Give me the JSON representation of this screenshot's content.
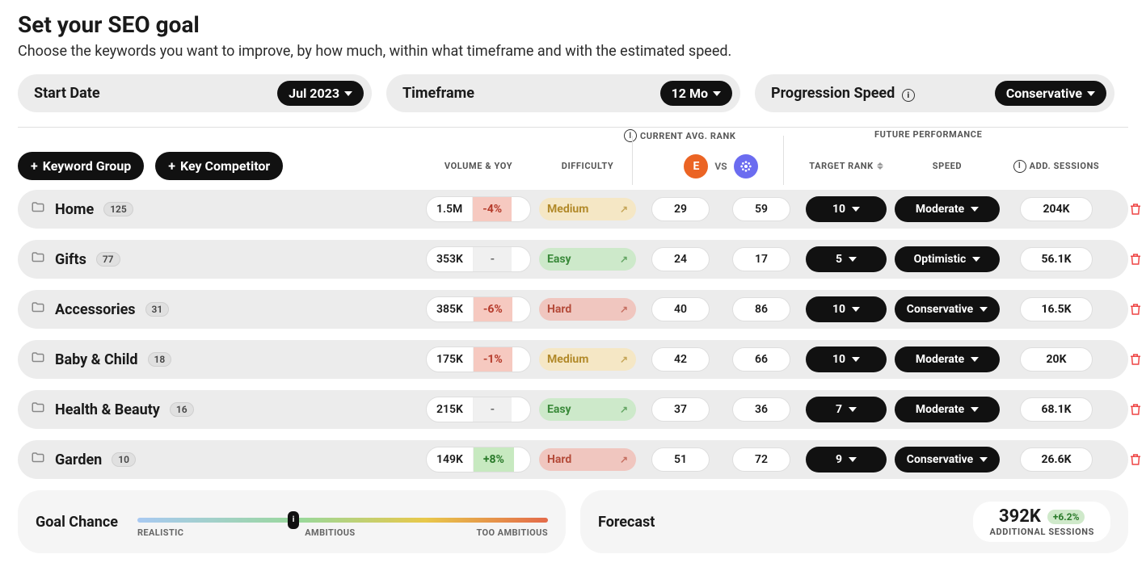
{
  "title": "Set your SEO goal",
  "subtitle": "Choose the keywords you want to improve, by how much, within what timeframe and with the estimated speed.",
  "controls": {
    "start_date": {
      "label": "Start Date",
      "value": "Jul 2023"
    },
    "timeframe": {
      "label": "Timeframe",
      "value": "12 Mo"
    },
    "speed": {
      "label": "Progression Speed",
      "value": "Conservative"
    }
  },
  "columns": {
    "volyoy": "VOLUME & YOY",
    "difficulty": "DIFFICULTY",
    "rank_header": "CURRENT AVG. RANK",
    "future_header": "FUTURE PERFORMANCE",
    "vs": "VS",
    "target_rank": "TARGET RANK",
    "speed": "SPEED",
    "sessions": "ADD. SESSIONS"
  },
  "buttons": {
    "keyword_group": "Keyword Group",
    "key_competitor": "Key Competitor"
  },
  "avatars": {
    "own": "E"
  },
  "rows": [
    {
      "name": "Home",
      "count": "125",
      "vol": "1.5M",
      "yoy": "-4%",
      "yoy_type": "neg",
      "diff": "Medium",
      "diff_type": "medium",
      "r1": "29",
      "r2": "59",
      "target": "10",
      "speed": "Moderate",
      "sess": "204K"
    },
    {
      "name": "Gifts",
      "count": "77",
      "vol": "353K",
      "yoy": "-",
      "yoy_type": "neutral",
      "diff": "Easy",
      "diff_type": "easy",
      "r1": "24",
      "r2": "17",
      "target": "5",
      "speed": "Optimistic",
      "sess": "56.1K"
    },
    {
      "name": "Accessories",
      "count": "31",
      "vol": "385K",
      "yoy": "-6%",
      "yoy_type": "neg",
      "diff": "Hard",
      "diff_type": "hard",
      "r1": "40",
      "r2": "86",
      "target": "10",
      "speed": "Conservative",
      "sess": "16.5K"
    },
    {
      "name": "Baby & Child",
      "count": "18",
      "vol": "175K",
      "yoy": "-1%",
      "yoy_type": "neg",
      "diff": "Medium",
      "diff_type": "medium",
      "r1": "42",
      "r2": "66",
      "target": "10",
      "speed": "Moderate",
      "sess": "20K"
    },
    {
      "name": "Health & Beauty",
      "count": "16",
      "vol": "215K",
      "yoy": "-",
      "yoy_type": "neutral",
      "diff": "Easy",
      "diff_type": "easy",
      "r1": "37",
      "r2": "36",
      "target": "7",
      "speed": "Moderate",
      "sess": "68.1K"
    },
    {
      "name": "Garden",
      "count": "10",
      "vol": "149K",
      "yoy": "+8%",
      "yoy_type": "pos",
      "diff": "Hard",
      "diff_type": "hard",
      "r1": "51",
      "r2": "72",
      "target": "9",
      "speed": "Conservative",
      "sess": "26.6K"
    }
  ],
  "goal_chance": {
    "label": "Goal Chance",
    "realistic": "REALISTIC",
    "ambitious": "AMBITIOUS",
    "too_ambitious": "TOO AMBITIOUS",
    "handle": "i"
  },
  "forecast": {
    "label": "Forecast",
    "value": "392K",
    "delta": "+6.2%",
    "sub": "ADDITIONAL SESSIONS"
  }
}
